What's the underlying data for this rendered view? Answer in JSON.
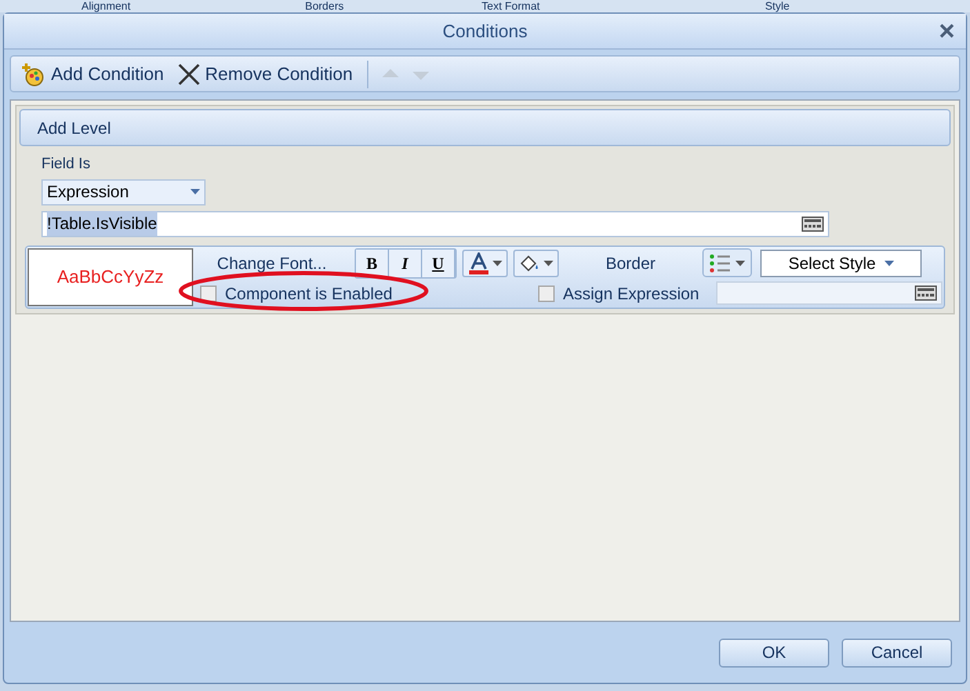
{
  "ribbon_groups": [
    "Alignment",
    "Borders",
    "Text Format",
    "Style"
  ],
  "window": {
    "title": "Conditions",
    "close": "×"
  },
  "toolbar": {
    "items": [
      {
        "kind": "add",
        "label": "Add Condition",
        "disabled": false
      },
      {
        "kind": "remove",
        "label": "Remove Condition",
        "disabled": false
      },
      {
        "kind": "up",
        "disabled": true
      },
      {
        "kind": "down",
        "disabled": true
      }
    ]
  },
  "level": {
    "header": "Add Level",
    "field_label": "Field Is",
    "field_value": "Expression",
    "expression": "!Table.IsVisible",
    "preview": "AaBbCcYyZz",
    "change_font": "Change Font...",
    "format_buttons": [
      {
        "label": "B",
        "kind": "bold",
        "selected": false
      },
      {
        "label": "I",
        "kind": "italic",
        "selected": false
      },
      {
        "label": "U",
        "kind": "underline",
        "selected": false
      }
    ],
    "border": "Border",
    "style_select": "Select Style",
    "component_enabled": {
      "label": "Component is Enabled",
      "checked": false,
      "highlighted": true
    },
    "assign_expression": {
      "label": "Assign Expression",
      "checked": false
    }
  },
  "buttons": [
    "OK",
    "Cancel"
  ]
}
